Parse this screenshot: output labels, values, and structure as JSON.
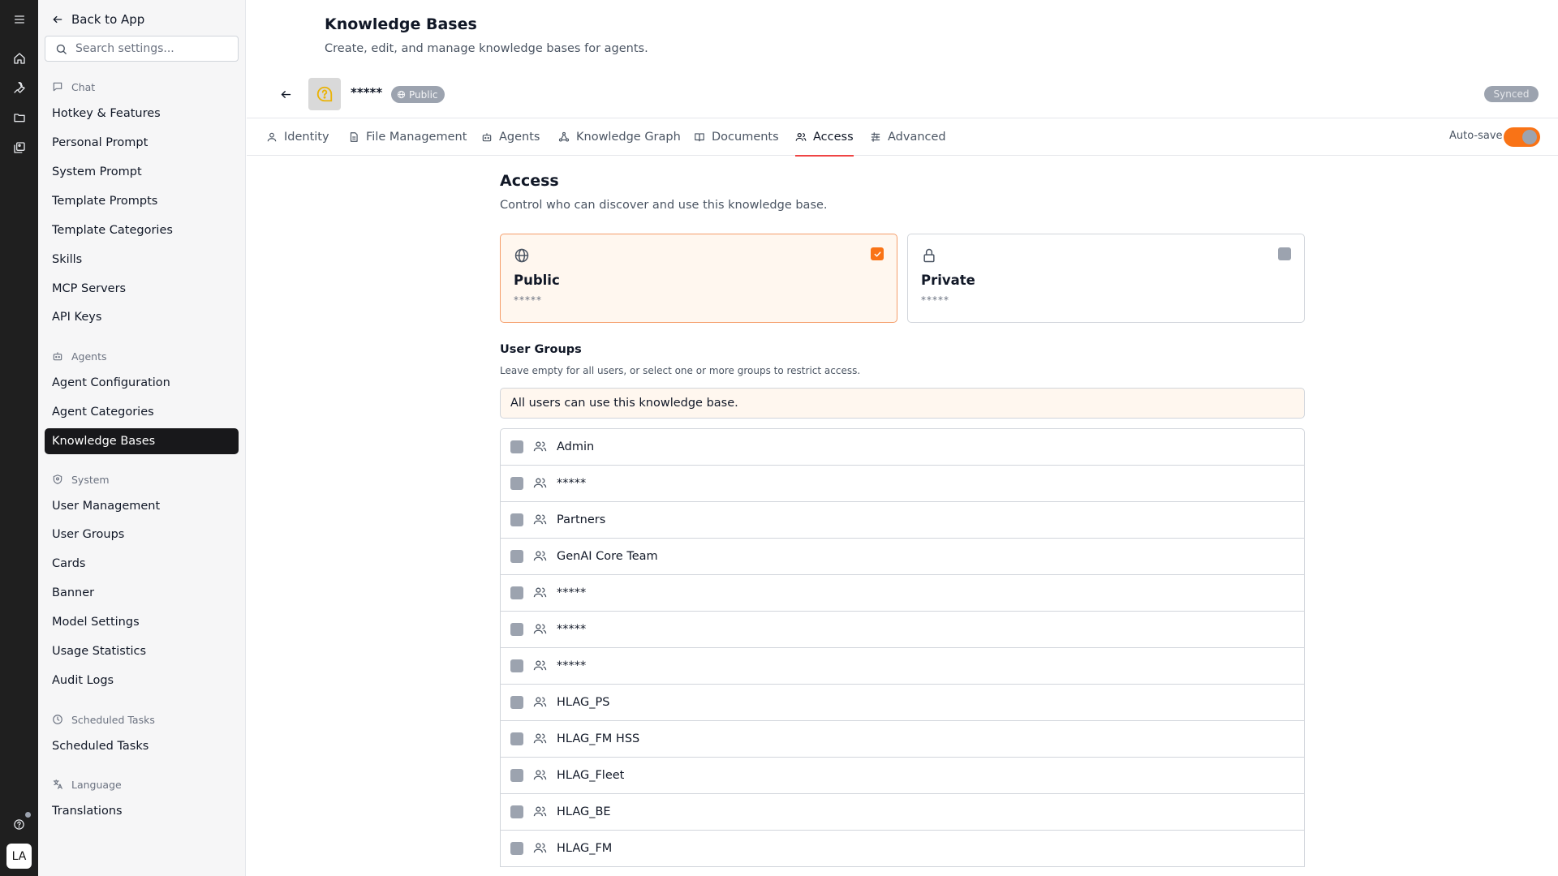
{
  "icons": {
    "rail": [
      "menu-icon",
      "home-icon",
      "wrench-icon",
      "folder-icon",
      "gallery-icon",
      "help-icon"
    ],
    "back": "arrow-left-icon",
    "search": "search-icon",
    "knowledge_base": "help-circle-icon",
    "globe": "globe-icon",
    "lock": "lock-icon",
    "users": "users-icon",
    "check": "check-icon"
  },
  "colors": {
    "accent": "#f97316",
    "accent_line": "#ef4444",
    "active_item_bg": "#18181b",
    "selected_card_bg": "#fff7ef"
  },
  "rail": {
    "avatar_initials": "LA"
  },
  "sidebar": {
    "back_label": "Back to App",
    "search_placeholder": "Search settings...",
    "sections": {
      "chat": "Chat",
      "agents": "Agents",
      "system": "System",
      "scheduled": "Scheduled Tasks",
      "language": "Language"
    },
    "chat_items": [
      "Hotkey & Features",
      "Personal Prompt",
      "System Prompt",
      "Template Prompts",
      "Template Categories",
      "Skills",
      "MCP Servers",
      "API Keys"
    ],
    "agents_items": [
      "Agent Configuration",
      "Agent Categories",
      "Knowledge Bases"
    ],
    "system_items": [
      "User Management",
      "User Groups",
      "Cards",
      "Banner",
      "Model Settings",
      "Usage Statistics",
      "Audit Logs"
    ],
    "scheduled_items": [
      "Scheduled Tasks"
    ],
    "language_items": [
      "Translations"
    ],
    "active_item": "Knowledge Bases"
  },
  "header": {
    "title": "Knowledge Bases",
    "subtitle": "Create, edit, and manage knowledge bases for agents."
  },
  "kb": {
    "name": "*****",
    "visibility_badge": "Public",
    "status": "Synced"
  },
  "tabs": {
    "identity": "Identity",
    "files": "File Management",
    "agents": "Agents",
    "graph": "Knowledge Graph",
    "documents": "Documents",
    "access": "Access",
    "advanced": "Advanced",
    "active": "Access"
  },
  "autosave": {
    "label": "Auto-save",
    "enabled": true
  },
  "access": {
    "title": "Access",
    "description": "Control who can discover and use this knowledge base.",
    "public": {
      "title": "Public",
      "desc": "*****",
      "selected": true
    },
    "private": {
      "title": "Private",
      "desc": "*****",
      "selected": false
    }
  },
  "user_groups": {
    "title": "User Groups",
    "description": "Leave empty for all users, or select one or more groups to restrict access.",
    "note": "All users can use this knowledge base.",
    "groups": [
      "Admin",
      "*****",
      "Partners",
      "GenAI Core Team",
      "*****",
      "*****",
      "*****",
      "HLAG_PS",
      "HLAG_FM HSS",
      "HLAG_Fleet",
      "HLAG_BE",
      "HLAG_FM"
    ]
  }
}
